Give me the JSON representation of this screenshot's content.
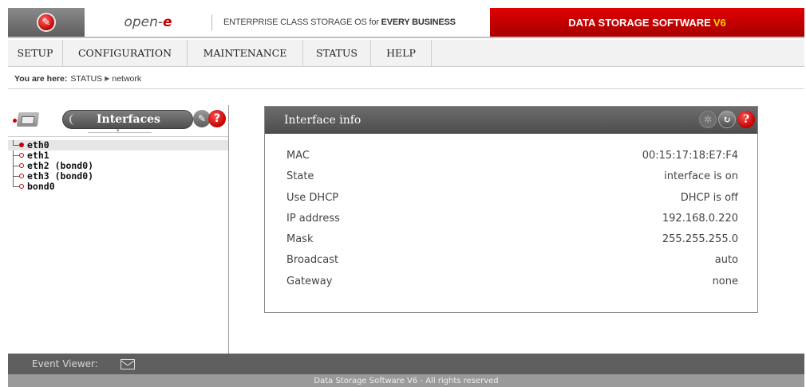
{
  "header": {
    "brand": "open-e",
    "tagline_prefix": "ENTERPRISE CLASS STORAGE OS for",
    "tagline_bold": "EVERY BUSINESS",
    "product": "DATA STORAGE SOFTWARE",
    "product_version": "V6",
    "logo_icon": "wrench-icon",
    "accent": "#cc0000"
  },
  "menu": {
    "items": [
      {
        "label": "SETUP"
      },
      {
        "label": "CONFIGURATION"
      },
      {
        "label": "MAINTENANCE"
      },
      {
        "label": "STATUS"
      },
      {
        "label": "HELP"
      }
    ]
  },
  "breadcrumb": {
    "prefix": "You are here:",
    "section": "STATUS",
    "page": "network"
  },
  "tree": {
    "tab_label": "Interfaces",
    "items": [
      {
        "label": "eth0"
      },
      {
        "label": "eth1"
      },
      {
        "label": "eth2 (bond0)"
      },
      {
        "label": "eth3 (bond0)"
      },
      {
        "label": "bond0"
      }
    ]
  },
  "info": {
    "title": "Interface info",
    "rows": [
      {
        "label": "MAC",
        "value": "00:15:17:18:E7:F4"
      },
      {
        "label": "State",
        "value": "interface is on"
      },
      {
        "label": "Use DHCP",
        "value": "DHCP is off"
      },
      {
        "label": "IP address",
        "value": "192.168.0.220"
      },
      {
        "label": "Mask",
        "value": "255.255.255.0"
      },
      {
        "label": "Broadcast",
        "value": "auto"
      },
      {
        "label": "Gateway",
        "value": "none"
      }
    ]
  },
  "footer": {
    "event_viewer": "Event Viewer:",
    "copyright": "Data Storage Software V6 - All rights reserved"
  }
}
